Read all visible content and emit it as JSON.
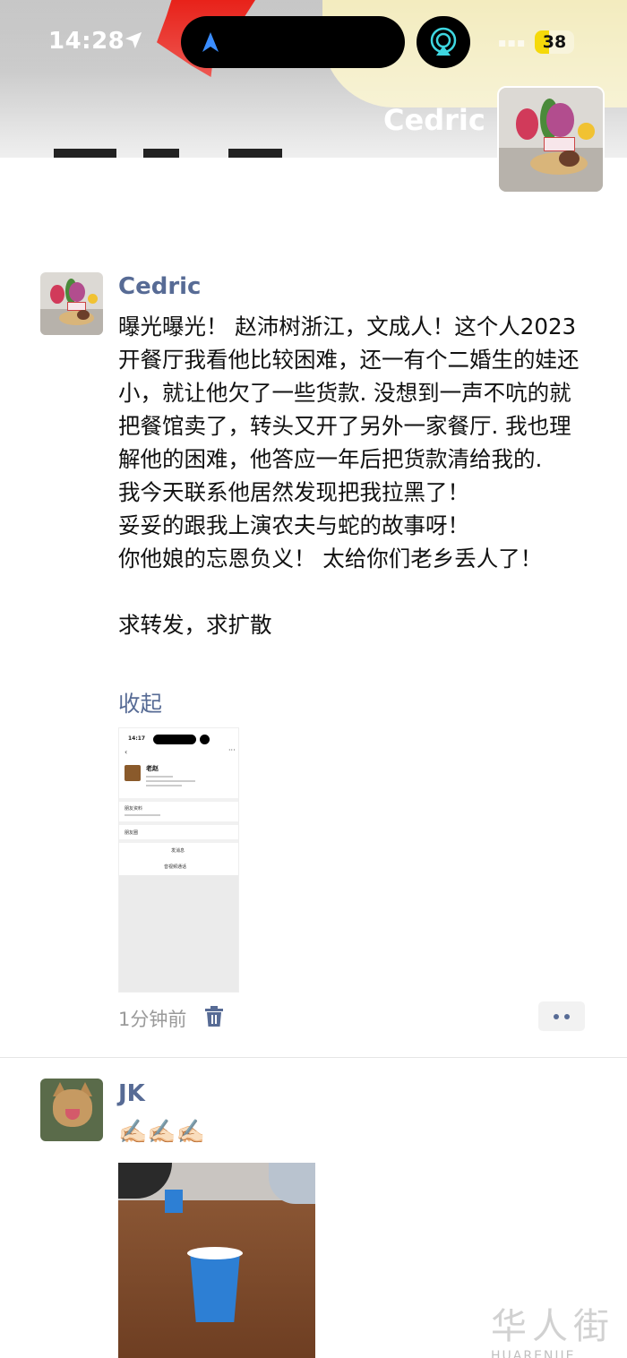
{
  "status_bar": {
    "time": "14:28",
    "battery": "38"
  },
  "header": {
    "name": "Cedric"
  },
  "posts": [
    {
      "author": "Cedric",
      "content": "曝光曝光！ 赵沛树浙江，文成人！这个人2023开餐厅我看他比较困难，还一有个二婚生的娃还小，就让他欠了一些货款. 没想到一声不吭的就把餐馆卖了，转头又开了另外一家餐厅. 我也理解他的困难，他答应一年后把货款清给我的.\n我今天联系他居然发现把我拉黑了！\n妥妥的跟我上演农夫与蛇的故事呀！\n你他娘的忘恩负义！ 太给你们老乡丢人了！\n\n求转发，求扩散",
      "collapse_label": "收起",
      "time": "1分钟前",
      "screenshot": {
        "time": "14:17",
        "name": "老赵",
        "field1": "朋友资料",
        "field2": "朋友圈",
        "action1": "发消息",
        "action2": "音视频通话"
      }
    },
    {
      "author": "JK",
      "content": "✍🏻✍🏻✍🏻"
    }
  ],
  "watermark": {
    "logo": "华人街",
    "text": "HUARENJIE"
  }
}
